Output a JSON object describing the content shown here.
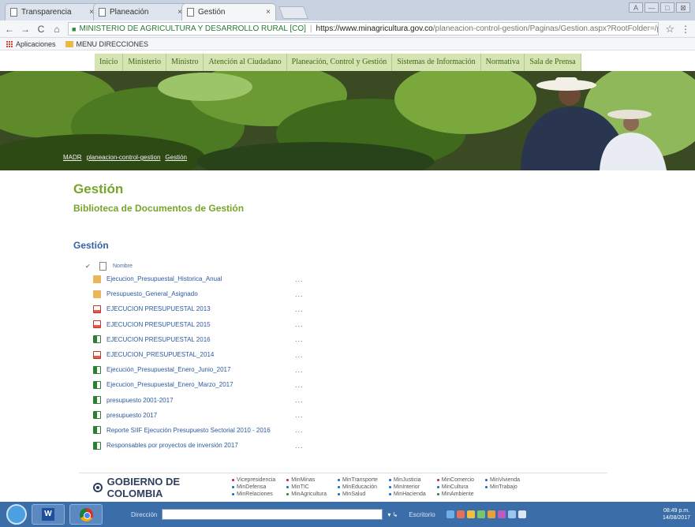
{
  "browser": {
    "tabs": [
      {
        "label": "Transparencia",
        "close": "×"
      },
      {
        "label": "Planeación",
        "close": "×"
      },
      {
        "label": "Gestión",
        "close": "×"
      }
    ],
    "window_controls": [
      "A",
      "—",
      "□",
      "⊠"
    ],
    "nav": {
      "back": "←",
      "forward": "→",
      "reload": "C",
      "home": "⌂"
    },
    "site_identity": "MINISTERIO DE AGRICULTURA Y DESARROLLO RURAL [CO]",
    "url_scheme": "https://",
    "url_domain": "www.minagricultura.gov.co",
    "url_path": "/planeacion-control-gestion/Paginas/Gestion.aspx?RootFolder=/planeacio...",
    "star": "☆",
    "menu": "⋮",
    "bookmarks": [
      {
        "label": "Aplicaciones",
        "icon": "apps-icon"
      },
      {
        "label": "MENU DIRECCIONES",
        "icon": "folder-icon"
      }
    ]
  },
  "site_nav": [
    "Inicio",
    "Ministerio",
    "Ministro",
    "Atención al Ciudadano",
    "Planeación, Control y Gestión",
    "Sistemas de Información",
    "Normativa",
    "Sala de Prensa"
  ],
  "breadcrumb": [
    "MADR",
    "planeacion-control-gestion",
    "Gestión"
  ],
  "page_title": "Gestión",
  "library_title": "Biblioteca de Documentos de Gestión",
  "section_title": "Gestión",
  "list": {
    "header_check": "✔",
    "header_label": "Nombre",
    "items": [
      {
        "name": "Ejecucion_Presupuestal_Historica_Anual",
        "type": "folder"
      },
      {
        "name": "Presupuesto_General_Asignado",
        "type": "folder"
      },
      {
        "name": "EJECUCION PRESUPUESTAL 2013",
        "type": "pdf"
      },
      {
        "name": "EJECUCION PRESUPUESTAL 2015",
        "type": "pdf"
      },
      {
        "name": "EJECUCION PRESUPUESTAL 2016",
        "type": "xls"
      },
      {
        "name": "EJECUCION_PRESUPUESTAL_2014",
        "type": "pdf"
      },
      {
        "name": "Ejecución_Presupuestal_Enero_Junio_2017",
        "type": "xls"
      },
      {
        "name": "Ejecucion_Presupuestal_Enero_Marzo_2017",
        "type": "xls"
      },
      {
        "name": "presupuesto 2001-2017",
        "type": "xls"
      },
      {
        "name": "presupuesto 2017",
        "type": "xls"
      },
      {
        "name": "Reporte SIIF Ejecución Presupuesto Sectorial 2010 - 2016",
        "type": "xls"
      },
      {
        "name": "Responsables por proyectos de inversión 2017",
        "type": "xls"
      }
    ],
    "more": "..."
  },
  "footer": {
    "gov_logo": "GOBIERNO DE COLOMBIA",
    "ministries": [
      {
        "label": "Vicepresidencia",
        "color": "#c2185b"
      },
      {
        "label": "MinMinas",
        "color": "#c2185b"
      },
      {
        "label": "MinTransporte",
        "color": "#1565c0"
      },
      {
        "label": "MinJusticia",
        "color": "#1565c0"
      },
      {
        "label": "MinComercio",
        "color": "#c2185b"
      },
      {
        "label": "MinVivienda",
        "color": "#1565c0"
      },
      {
        "label": "MinDefensa",
        "color": "#1565c0"
      },
      {
        "label": "MinTIC",
        "color": "#1565c0"
      },
      {
        "label": "MinEducación",
        "color": "#1565c0"
      },
      {
        "label": "MinInterior",
        "color": "#1565c0"
      },
      {
        "label": "MinCultura",
        "color": "#1565c0"
      },
      {
        "label": "MinTrabajo",
        "color": "#1565c0"
      },
      {
        "label": "MinRelaciones",
        "color": "#1565c0"
      },
      {
        "label": "MinAgricultura",
        "color": "#2e7d32"
      },
      {
        "label": "MinSalud",
        "color": "#1565c0"
      },
      {
        "label": "MinHacienda",
        "color": "#1565c0"
      },
      {
        "label": "MinAmbiente",
        "color": "#2e7d32"
      },
      {
        "label": "",
        "color": ""
      }
    ]
  },
  "taskbar": {
    "address_label": "Dirección",
    "go_arrow": "▾ ↳",
    "desktop_label": "Escritorio",
    "clock_time": "08:49 p.m.",
    "clock_date": "14/08/2017"
  },
  "colors": {
    "accent_green": "#76a52a",
    "link_blue": "#2d5aa0",
    "nav_bg": "#d6e3b2"
  }
}
